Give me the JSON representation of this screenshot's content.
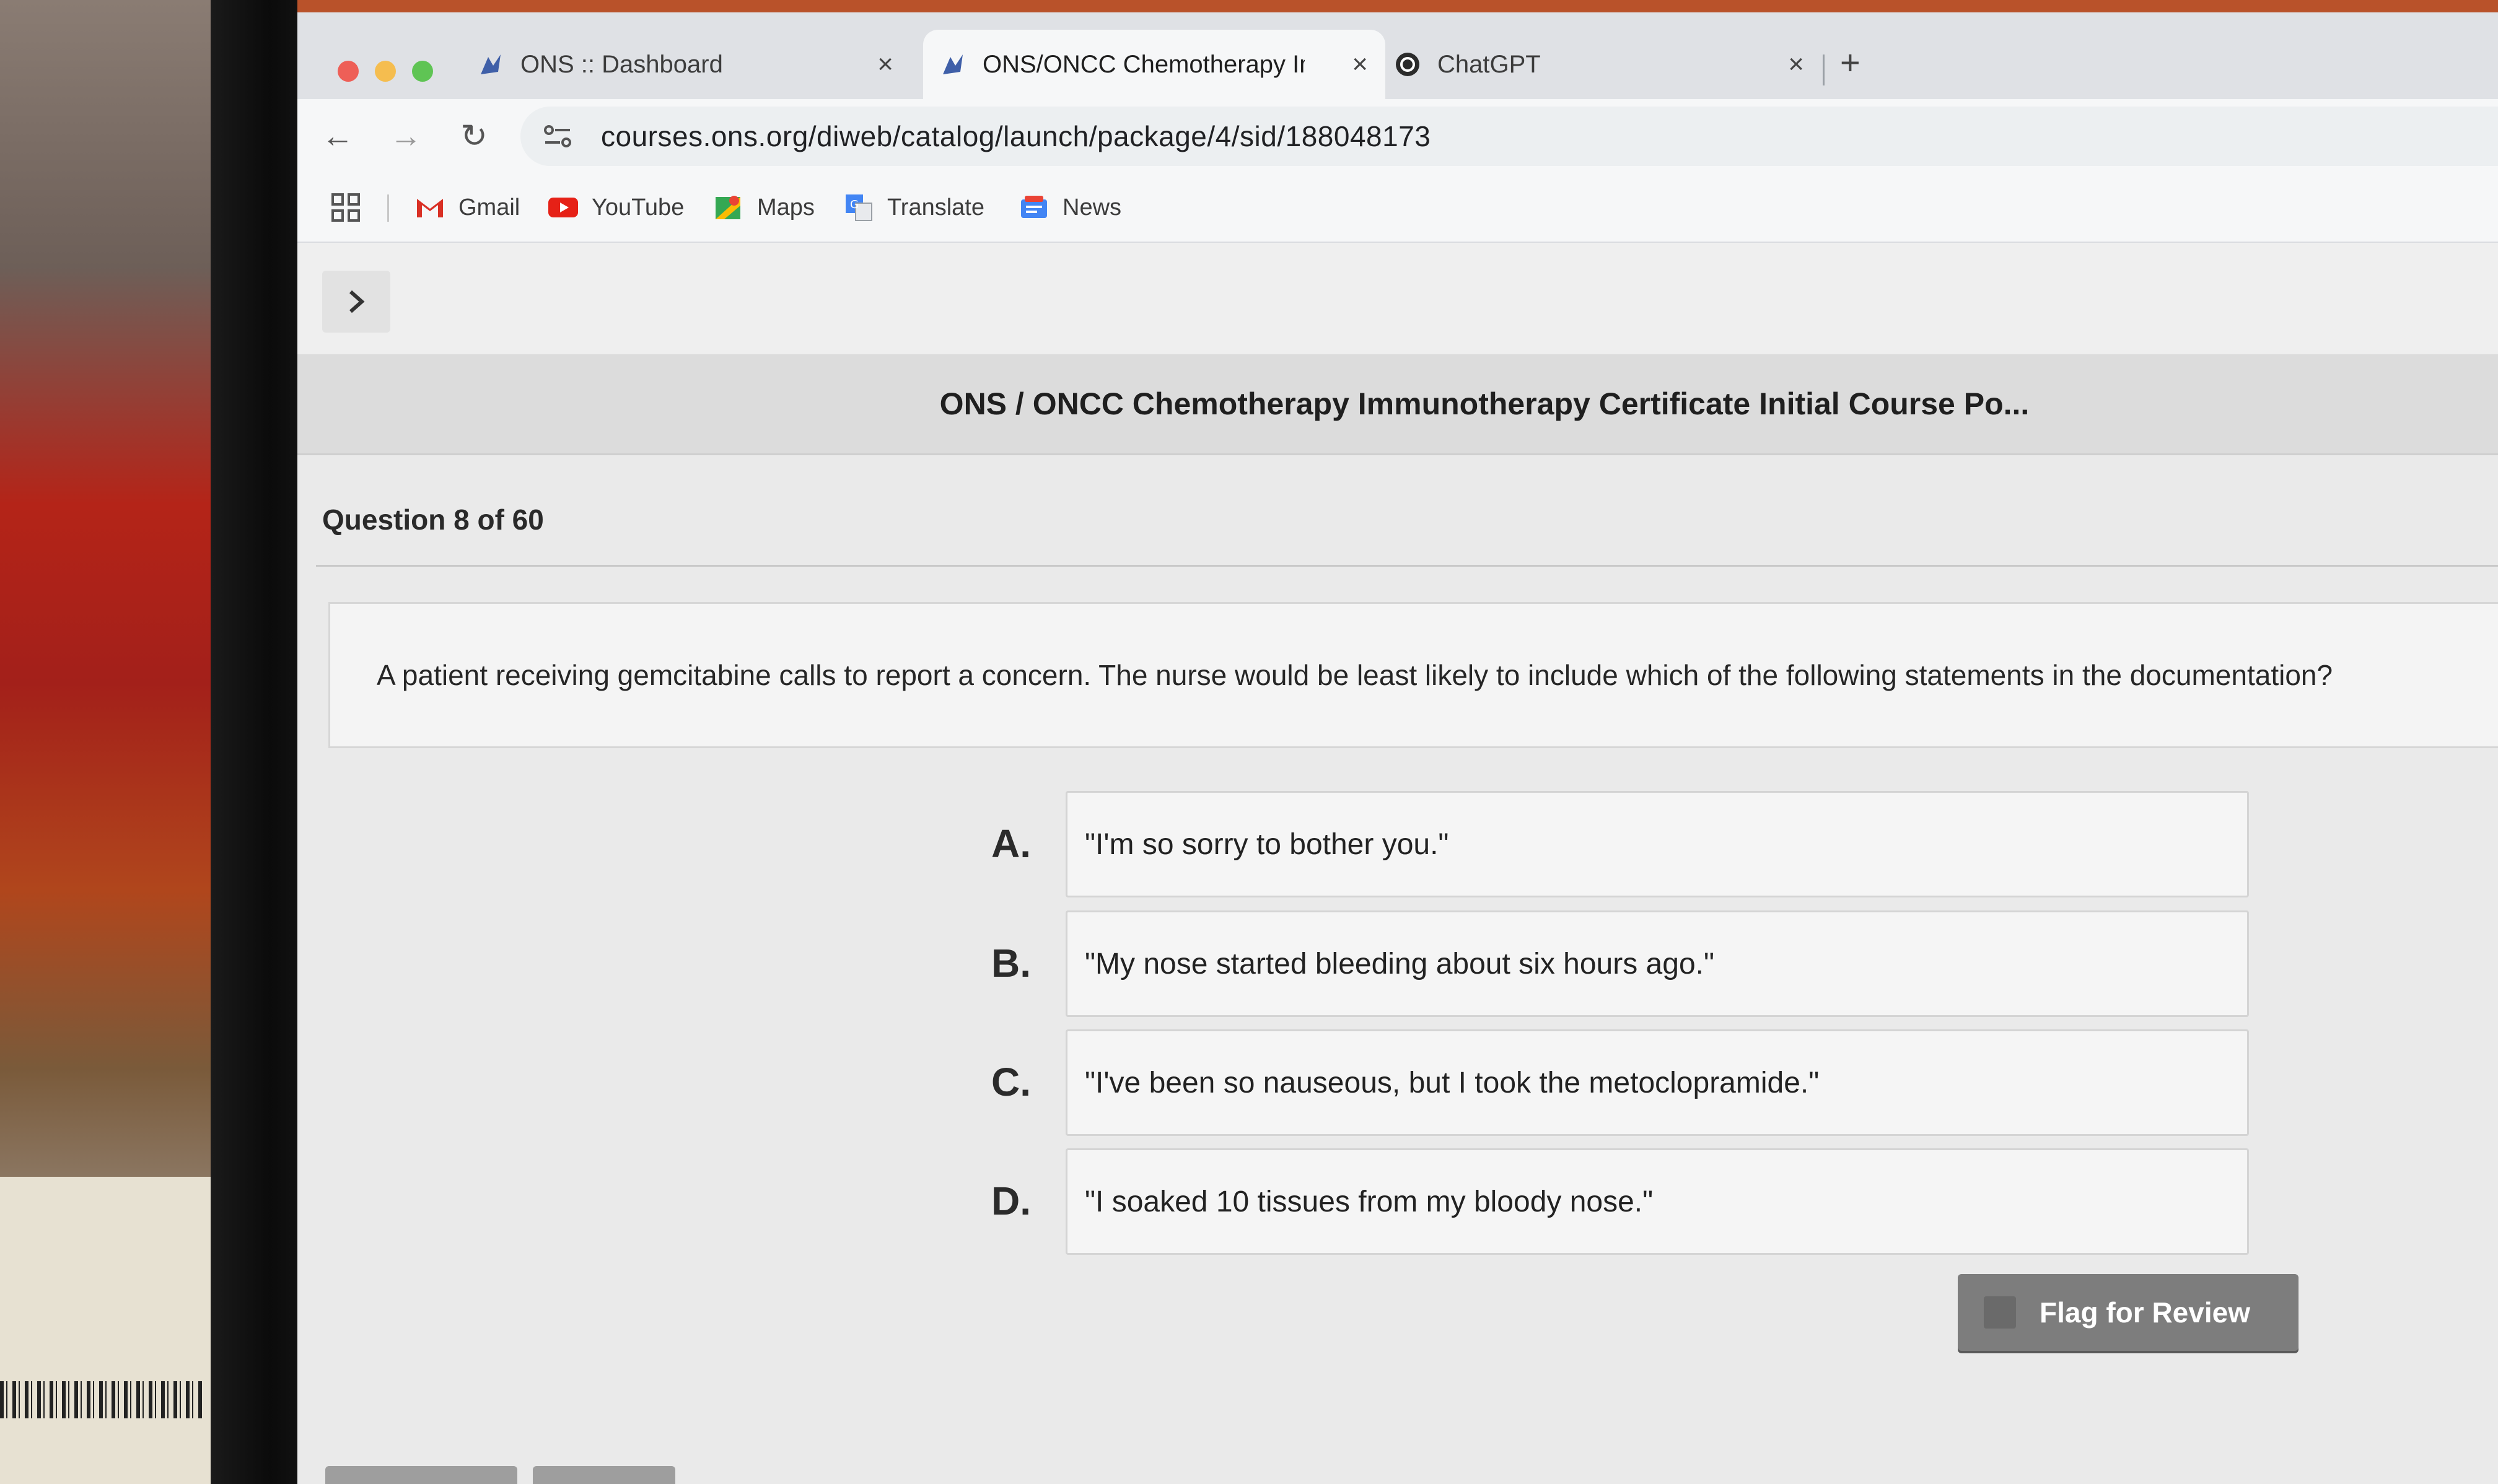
{
  "browser": {
    "tabs": [
      {
        "title": "ONS :: Dashboard",
        "active": false,
        "icon": "ons-favicon"
      },
      {
        "title": "ONS/ONCC Chemotherapy Im",
        "active": true,
        "icon": "ons-favicon"
      },
      {
        "title": "ChatGPT",
        "active": false,
        "icon": "chatgpt-favicon"
      }
    ],
    "url": "courses.ons.org/diweb/catalog/launch/package/4/sid/188048173",
    "bookmarks": [
      "Gmail",
      "YouTube",
      "Maps",
      "Translate",
      "News"
    ]
  },
  "course": {
    "title": "ONS / ONCC Chemotherapy Immunotherapy Certificate Initial Course Po..."
  },
  "question": {
    "header": "Question 8 of 60",
    "text": "A patient receiving gemcitabine calls to report a concern. The nurse would be least likely to include which of the following statements in the documentation?",
    "options": [
      {
        "letter": "A.",
        "text": "\"I'm so sorry to bother you.\""
      },
      {
        "letter": "B.",
        "text": "\"My nose started bleeding about six hours ago.\""
      },
      {
        "letter": "C.",
        "text": "\"I've been so nauseous, but I took the metoclopramide.\""
      },
      {
        "letter": "D.",
        "text": "\"I soaked 10 tissues from my bloody nose.\""
      }
    ]
  },
  "actions": {
    "flag_label": "Flag for Review"
  },
  "colors": {
    "accent_tab_active": "#f6f7f8",
    "flag_button": "#7d7d7d"
  }
}
